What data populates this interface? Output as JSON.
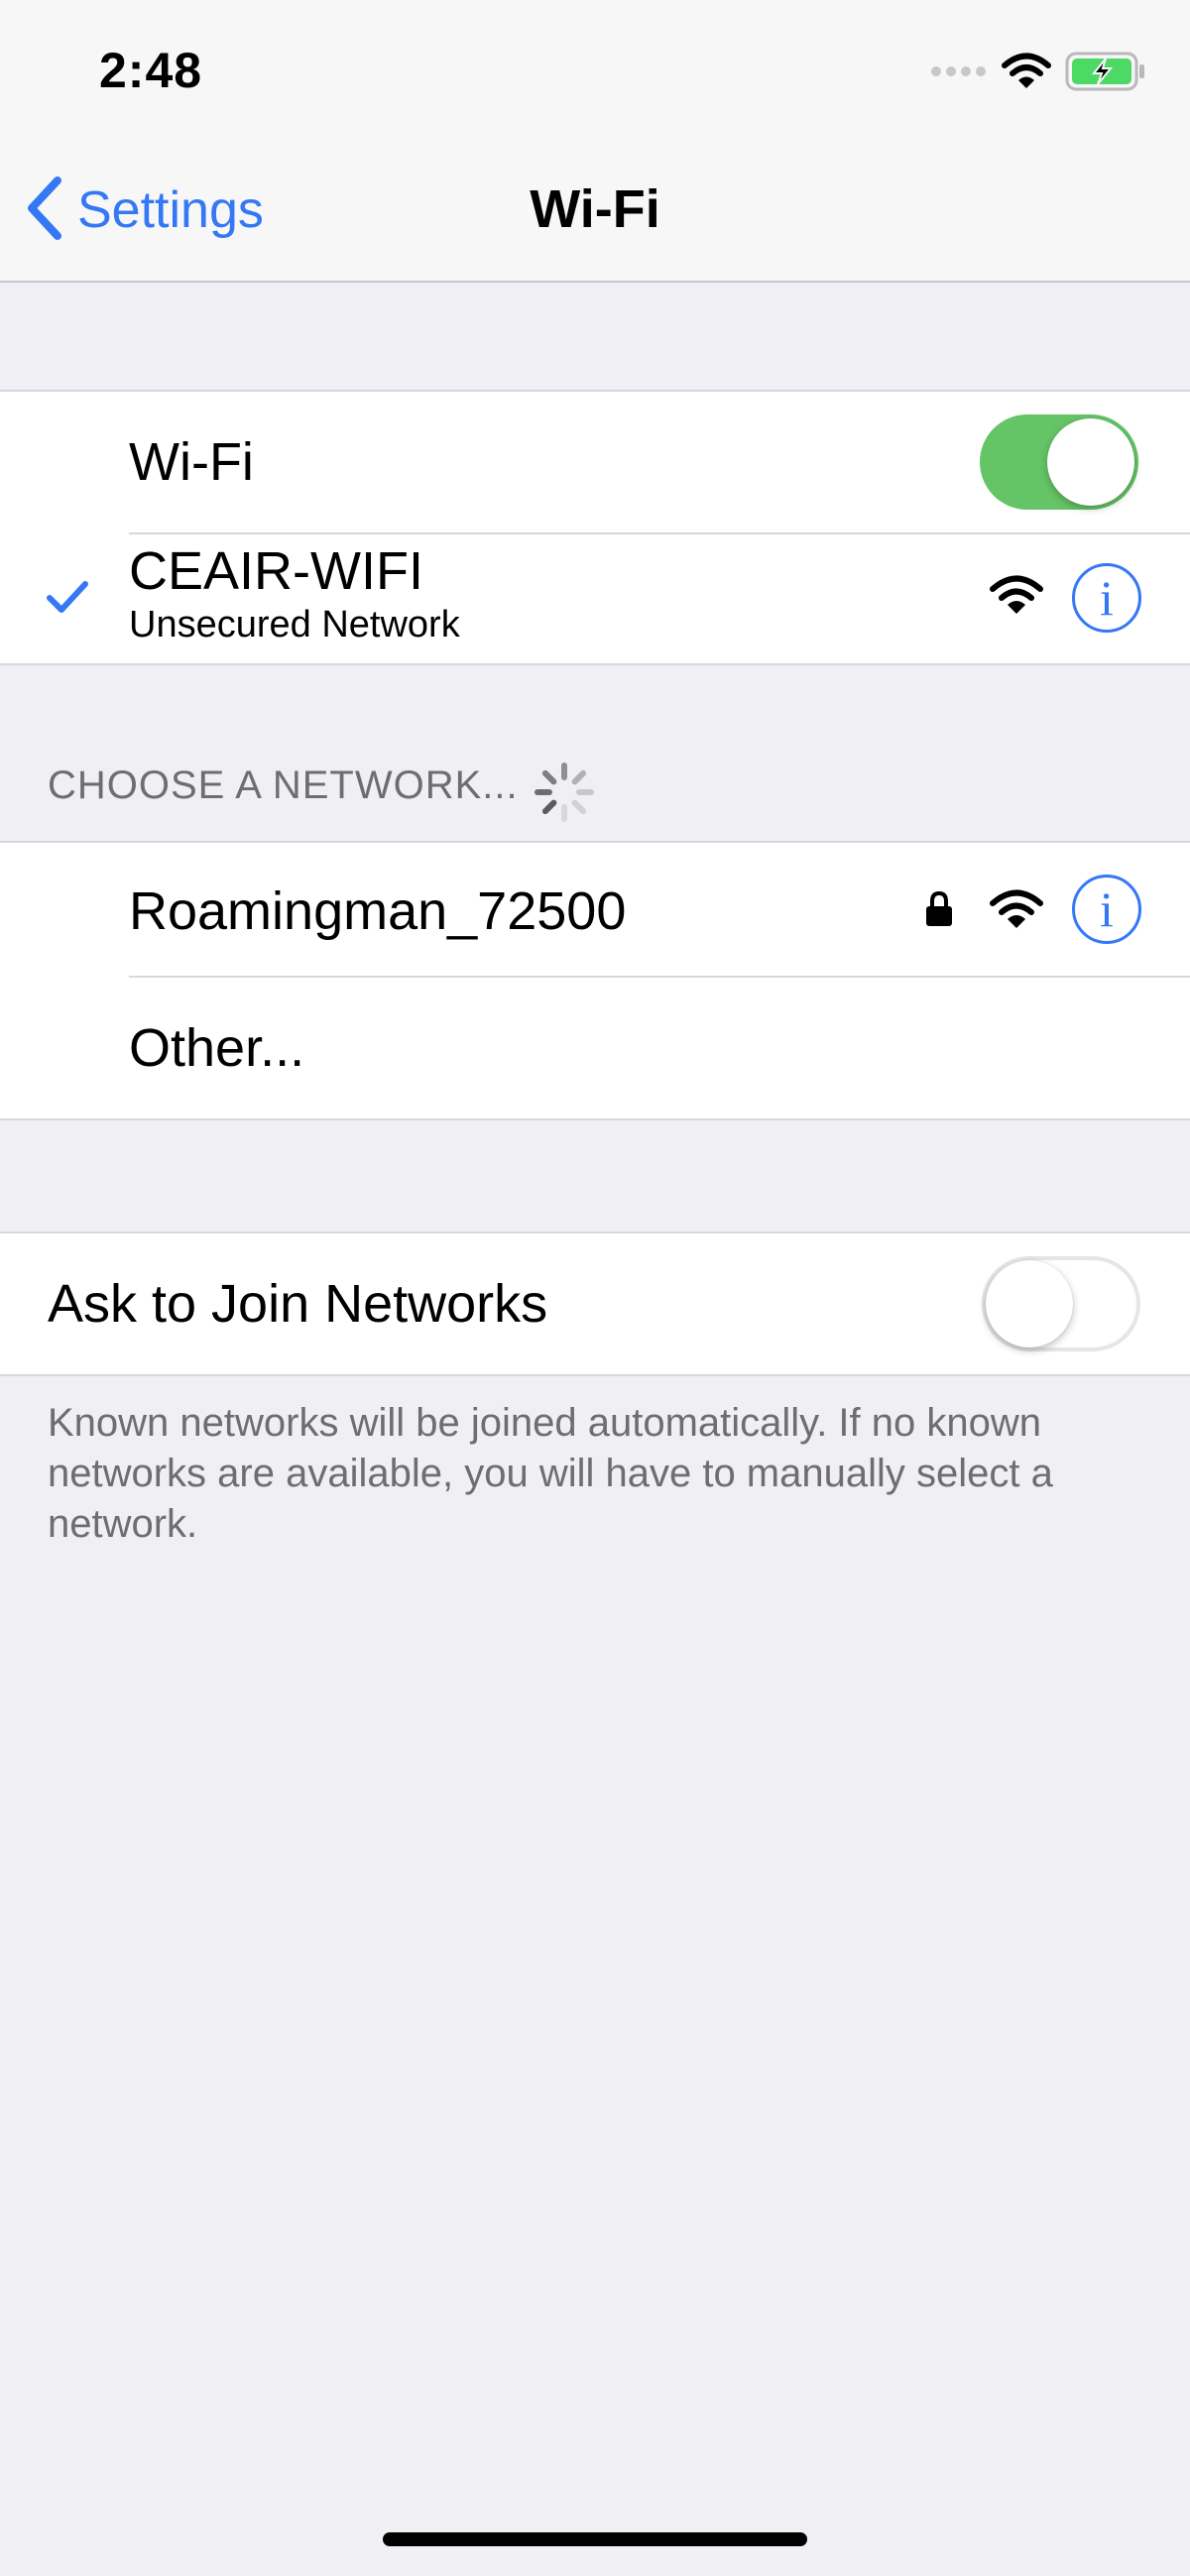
{
  "status_bar": {
    "time": "2:48",
    "icons": [
      "cellular-dots-icon",
      "wifi-icon",
      "battery-charging-icon"
    ],
    "battery_color": "#4cd964"
  },
  "nav": {
    "back_label": "Settings",
    "title": "Wi-Fi"
  },
  "wifi_toggle": {
    "label": "Wi-Fi",
    "on": true
  },
  "connected_network": {
    "name": "CEAIR-WIFI",
    "security": "Unsecured Network",
    "icons": [
      "checkmark-icon",
      "wifi-signal-icon",
      "info-icon"
    ]
  },
  "choose_network": {
    "header": "CHOOSE A NETWORK...",
    "networks": [
      {
        "name": "Roamingman_72500",
        "icons": [
          "lock-icon",
          "wifi-signal-icon",
          "info-icon"
        ]
      }
    ],
    "other_label": "Other..."
  },
  "ask_to_join": {
    "label": "Ask to Join Networks",
    "on": false,
    "footer": "Known networks will be joined automatically. If no known networks are available, you will have to manually select a network."
  },
  "colors": {
    "accent": "#3478f6",
    "toggle_on": "#65c466",
    "background": "#efeff4",
    "secondary_text": "#6d6d72"
  }
}
